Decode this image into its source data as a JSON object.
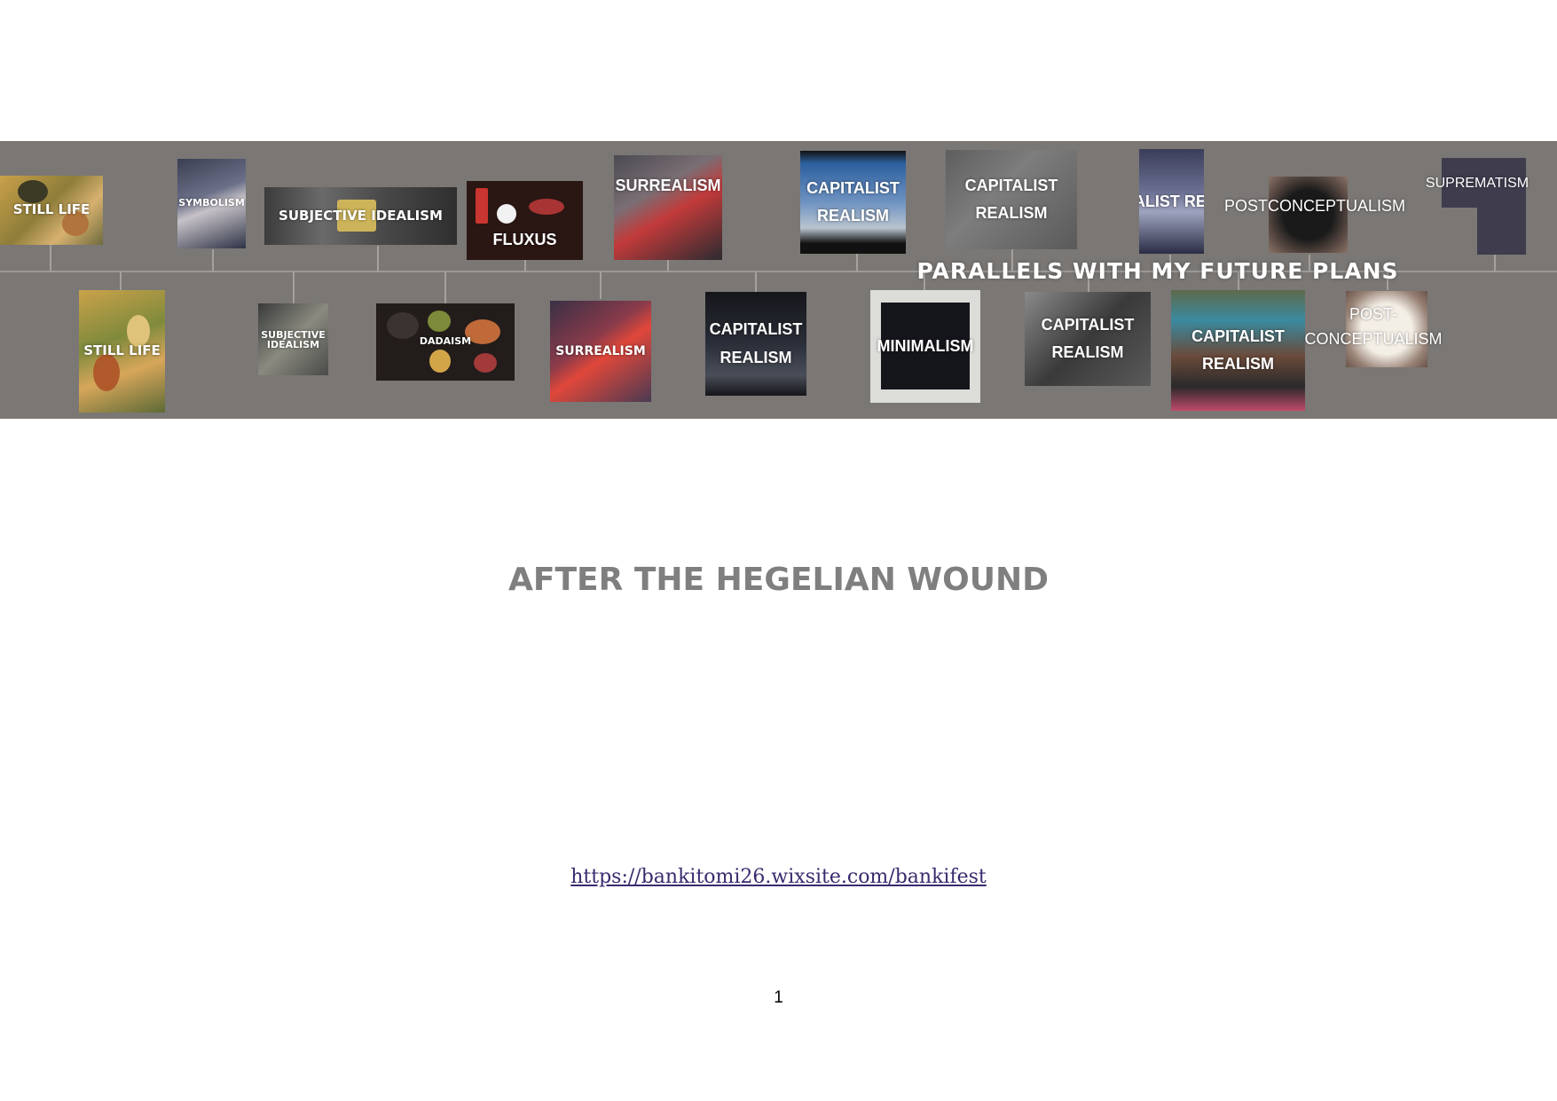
{
  "timeline": {
    "title": "PARALLELS WITH MY FUTURE PLANS",
    "top_row": [
      {
        "label": "STILL LIFE"
      },
      {
        "label": "SYMBOLISM"
      },
      {
        "label": "SUBJECTIVE IDEALISM"
      },
      {
        "label": "FLUXUS"
      },
      {
        "label": "SURREALISM"
      },
      {
        "label": "CAPITALIST REALISM"
      },
      {
        "label": "CAPITALIST REALISM"
      },
      {
        "label": "CAPITALIST REALISM"
      },
      {
        "label": "POSTCONCEPTUALISM"
      },
      {
        "label": "SUPREMATISM"
      }
    ],
    "bottom_row": [
      {
        "label": "STILL LIFE"
      },
      {
        "label": "SUBJECTIVE IDEALISM"
      },
      {
        "label": "DADAISM"
      },
      {
        "label": "SURREALISM"
      },
      {
        "label": "CAPITALIST REALISM"
      },
      {
        "label": "MINIMALISM"
      },
      {
        "label": "CAPITALIST REALISM"
      },
      {
        "label": "CAPITALIST REALISM"
      },
      {
        "label": "POST-CONCEPTUALISM"
      }
    ]
  },
  "document": {
    "title": "AFTER THE HEGELIAN WOUND",
    "link": "https://bankitomi26.wixsite.com/bankifest",
    "page_number": "1"
  }
}
